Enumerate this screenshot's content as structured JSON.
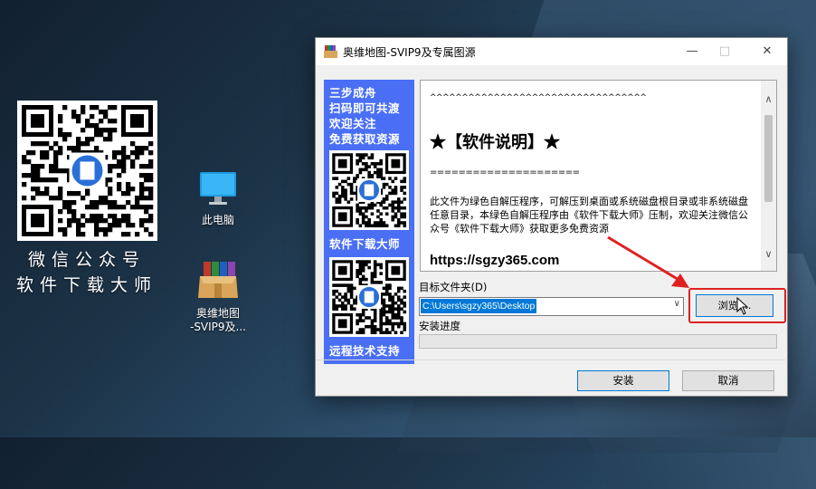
{
  "desktop": {
    "qr_caption_line1": "微信公众号",
    "qr_caption_line2": "软件下载大师",
    "icons": [
      {
        "label": "此电脑"
      },
      {
        "label": "奥维地图\n-SVIP9及..."
      }
    ]
  },
  "window": {
    "title": "奥维地图-SVIP9及专属图源",
    "left_panel": {
      "lines": [
        "三步成舟",
        "扫码即可共渡",
        "欢迎关注",
        "免费获取资源"
      ],
      "label_mid": "软件下载大师",
      "label_bottom": "远程技术支持"
    },
    "description": {
      "carets": "^^^^^^^^^^^^^^^^^^^^^^^^^^^^^^^^^^",
      "heading": "★【软件说明】★",
      "equals": "=====================",
      "body": "此文件为绿色自解压程序，可解压到桌面或系统磁盘根目录或非系统磁盘任意目录，本绿色自解压程序由《软件下载大师》压制，欢迎关注微信公众号《软件下载大师》获取更多免费资源",
      "url": "https://sgzy365.com"
    },
    "dest_label": "目标文件夹(D)",
    "dest_value": "C:\\Users\\sgzy365\\Desktop",
    "browse_label": "浏览(...",
    "progress_label": "安装进度",
    "progress_value": 0,
    "install_label": "安装",
    "cancel_label": "取消"
  },
  "colors": {
    "panel_blue": "#4a6ff5",
    "selection_blue": "#0078d7",
    "highlight_red": "#e02020"
  }
}
